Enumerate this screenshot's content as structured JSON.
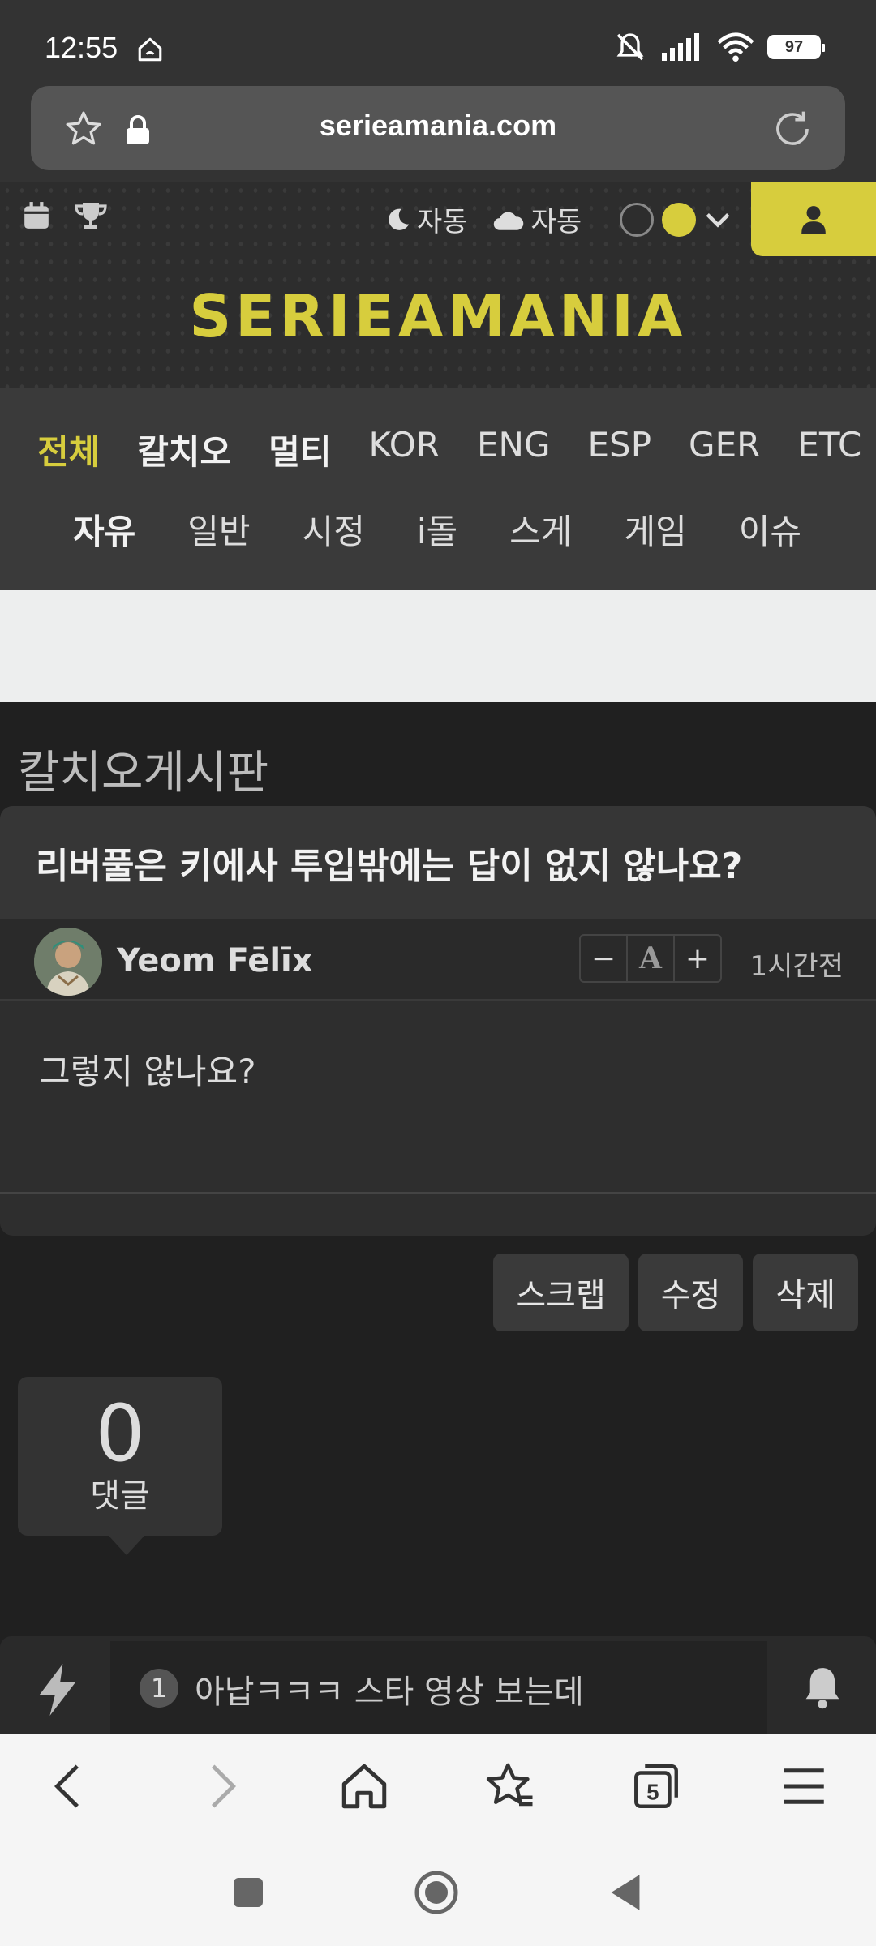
{
  "status": {
    "time": "12:55",
    "battery": "97"
  },
  "browser": {
    "url": "serieamania.com"
  },
  "header": {
    "toggle_dark": "자동",
    "toggle_weather": "자동",
    "logo": "SERIEAMANIA",
    "accent_color": "#d7cd3d"
  },
  "nav": {
    "row1": [
      "전체",
      "칼치오",
      "멀티",
      "KOR",
      "ENG",
      "ESP",
      "GER",
      "ETC"
    ],
    "row2": [
      "자유",
      "일반",
      "시정",
      "i돌",
      "스게",
      "게임",
      "이슈"
    ]
  },
  "board": {
    "title": "칼치오게시판"
  },
  "post": {
    "title": "리버풀은 키에사 투입밖에는 답이 없지 않나요?",
    "author": "Yeom Fēlīx",
    "fs_minus": "−",
    "fs_a": "A",
    "fs_plus": "+",
    "time": "1시간전",
    "body": "그렇지 않나요?"
  },
  "actions": {
    "scrap": "스크랩",
    "edit": "수정",
    "delete": "삭제"
  },
  "comments": {
    "count": "0",
    "label": "댓글"
  },
  "ticker": {
    "rank": "1",
    "text": "아납ㅋㅋㅋ 스타 영상 보는데"
  }
}
